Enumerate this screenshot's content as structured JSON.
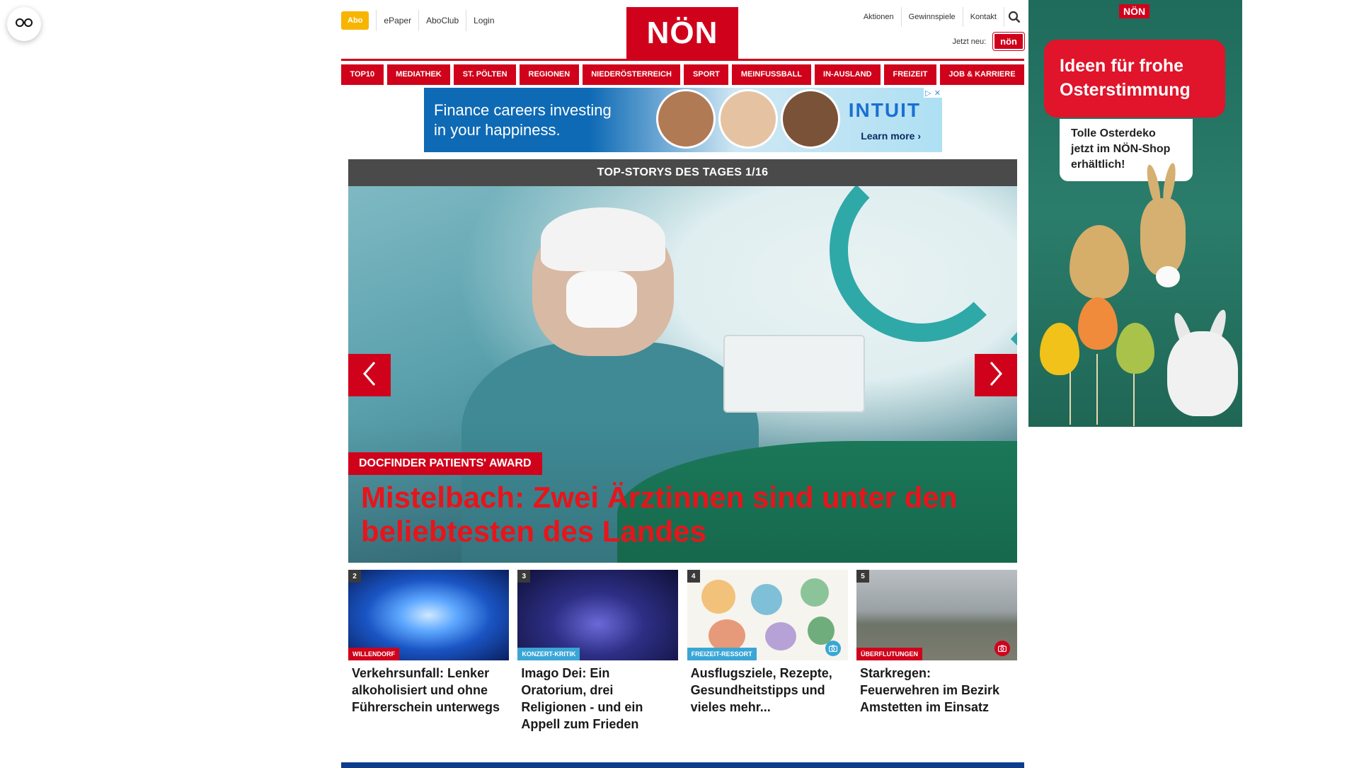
{
  "reader_button": {
    "icon": "glasses-icon"
  },
  "topbar": {
    "abo": "Abo",
    "links": [
      "ePaper",
      "AboClub",
      "Login"
    ],
    "right_links": [
      "Aktionen",
      "Gewinnspiele",
      "Kontakt"
    ],
    "jetzt_label": "Jetzt neu:",
    "jetzt_badge": "nön"
  },
  "logo": "NÖN",
  "nav": [
    "TOP10",
    "MEDIATHEK",
    "ST. PÖLTEN",
    "REGIONEN",
    "NIEDERÖSTERREICH",
    "SPORT",
    "MEINFUSSBALL",
    "IN-AUSLAND",
    "FREIZEIT",
    "JOB & KARRIERE"
  ],
  "banner_ad": {
    "text_line1": "Finance careers investing",
    "text_line2": "in your happiness.",
    "brand": "INTUIT",
    "cta": "Learn more ›"
  },
  "top_stories": {
    "header": "TOP-STORYS DES TAGES 1/16",
    "hero": {
      "kicker": "DOCFINDER PATIENTS' AWARD",
      "title": "Mistelbach: Zwei Ärztinnen sind unter den beliebtesten des Landes"
    },
    "cards": [
      {
        "num": "2",
        "category": "WILLENDORF",
        "headline": "Verkehrsunfall: Lenker alkoholisiert und ohne Führerschein unterwegs"
      },
      {
        "num": "3",
        "category": "KONZERT-KRITIK",
        "headline": "Imago Dei: Ein Oratorium, drei Religionen - und ein Appell zum Frieden"
      },
      {
        "num": "4",
        "category": "FREIZEIT-RESSORT",
        "headline": "Ausflugsziele, Rezepte, Gesundheitstipps und vieles mehr..."
      },
      {
        "num": "5",
        "category": "ÜBERFLUTUNGEN",
        "headline": "Starkregen: Feuerwehren im Bezirk Amstetten im Einsatz"
      }
    ]
  },
  "sky_ad": {
    "logo": "NÖN",
    "headline_line1": "Ideen für frohe",
    "headline_line2": "Osterstimmung",
    "sub_line1": "Tolle Osterdeko",
    "sub_line2": "jetzt im NÖN-Shop",
    "sub_line3": "erhältlich!"
  },
  "colors": {
    "brand_red": "#d0021b",
    "abo_yellow": "#f7b500",
    "dark_header": "#4a4a4a",
    "accent_blue": "#3aa6d6"
  }
}
